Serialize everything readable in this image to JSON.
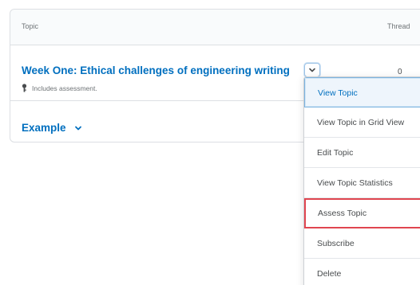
{
  "table": {
    "columns": {
      "topic": "Topic",
      "threads": "Thread"
    },
    "rows": [
      {
        "title": "Week One: Ethical challenges of engineering writing",
        "threads": "0",
        "note": "Includes assessment."
      }
    ],
    "category": {
      "title": "Example"
    }
  },
  "dropdown": {
    "items": [
      {
        "label": "View Topic"
      },
      {
        "label": "View Topic in Grid View"
      },
      {
        "label": "Edit Topic"
      },
      {
        "label": "View Topic Statistics"
      },
      {
        "label": "Assess Topic"
      },
      {
        "label": "Subscribe"
      },
      {
        "label": "Delete"
      }
    ]
  },
  "colors": {
    "link": "#006fbf",
    "highlight_border": "#e0454f",
    "active_item_bg": "#eef5fc"
  },
  "icons": {
    "menu_toggle": "chevron-down-icon",
    "assessment": "key-icon",
    "category_toggle": "chevron-down-icon"
  }
}
